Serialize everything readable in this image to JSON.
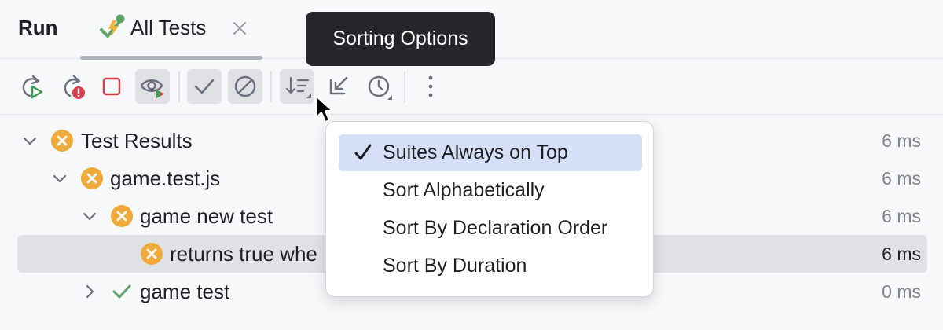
{
  "header": {
    "run_label": "Run",
    "tab": {
      "label": "All Tests",
      "icon": "test-run-icon"
    }
  },
  "tooltip": {
    "text": "Sorting Options"
  },
  "toolbar": {
    "buttons": [
      {
        "name": "rerun-button",
        "icon": "rerun-icon"
      },
      {
        "name": "rerun-failed-button",
        "icon": "rerun-failed-icon"
      },
      {
        "name": "stop-button",
        "icon": "stop-icon"
      },
      {
        "name": "watch-toggle",
        "icon": "eye-icon",
        "pressed": true
      },
      {
        "name": "show-passed-toggle",
        "icon": "check-icon",
        "pressed": true
      },
      {
        "name": "show-ignored-toggle",
        "icon": "ignored-icon",
        "pressed": true
      },
      {
        "name": "sort-button",
        "icon": "sort-icon",
        "pressed": true
      },
      {
        "name": "import-results-button",
        "icon": "import-icon"
      },
      {
        "name": "history-button",
        "icon": "clock-icon"
      },
      {
        "name": "more-button",
        "icon": "more-vertical-icon"
      }
    ]
  },
  "tree": {
    "rows": [
      {
        "label": "Test Results",
        "time": "6 ms",
        "status": "failed",
        "expanded": true
      },
      {
        "label": "game.test.js",
        "time": "6 ms",
        "status": "failed",
        "expanded": true
      },
      {
        "label": "game new test",
        "time": "6 ms",
        "status": "failed",
        "expanded": true
      },
      {
        "label": "returns true whe",
        "time": "6 ms",
        "status": "failed",
        "selected": true
      },
      {
        "label": "game test",
        "time": "0 ms",
        "status": "passed",
        "expanded": false
      }
    ]
  },
  "menu": {
    "items": [
      {
        "label": "Suites Always on Top",
        "checked": true,
        "highlighted": true
      },
      {
        "label": "Sort Alphabetically",
        "checked": false
      },
      {
        "label": "Sort By Declaration Order",
        "checked": false
      },
      {
        "label": "Sort By Duration",
        "checked": false
      }
    ]
  },
  "colors": {
    "failed": "#f0a93b",
    "passed": "#5fa36b",
    "stop": "#db3b4b",
    "run_green": "#3e9b4f",
    "menu_highlight": "#d5e0f7",
    "tooltip_bg": "#25262b"
  }
}
